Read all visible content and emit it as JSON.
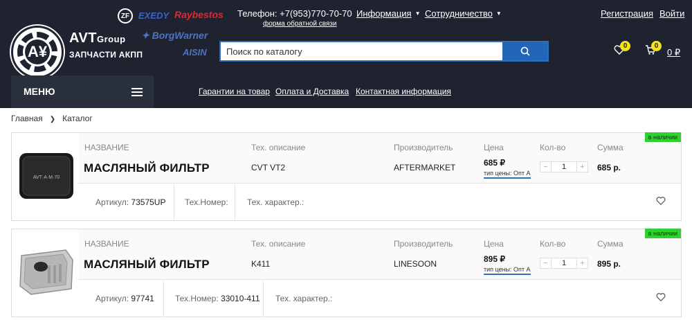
{
  "header": {
    "logo_letter": "A¥",
    "brand_title": "AVT",
    "brand_suffix": "Group",
    "brand_subtitle": "ЗАПЧАСТИ АКПП",
    "partners": [
      "ZF",
      "EXEDY",
      "Raybestos",
      "BorgWarner",
      "AISIN"
    ],
    "phone": "Телефон: +7(953)770-70-70",
    "feedback_link": "форма обратной связи",
    "nav": [
      {
        "label": "Информация",
        "icon": "caret-down-icon"
      },
      {
        "label": "Сотрудничество",
        "icon": "caret-down-icon"
      }
    ],
    "register": "Регистрация",
    "login": "Войти",
    "search_placeholder": "Поиск по каталогу",
    "wishlist_count": "0",
    "cart_count": "0",
    "cart_sum": "0 ₽",
    "menu_label": "МЕНЮ",
    "subnav": [
      "Гарантии на товар",
      "Оплата и Доставка",
      "Контактная информация"
    ]
  },
  "breadcrumb": [
    "Главная",
    "Каталог"
  ],
  "columns": {
    "name": "НАЗВАНИЕ",
    "desc": "Тех. описание",
    "maker": "Производитель",
    "price": "Цена",
    "qty": "Кол-во",
    "sum": "Сумма"
  },
  "products": [
    {
      "name": "МАСЛЯНЫЙ ФИЛЬТР",
      "desc": "CVT VT2",
      "maker": "AFTERMARKET",
      "price": "685 ₽",
      "price_type": "тип цены: Опт А",
      "qty": "1",
      "sum": "685 р.",
      "stock": "в наличии",
      "article_label": "Артикул:",
      "article": "73575UP",
      "tech_no_label": "Тех.Номер:",
      "tech_no": "",
      "tech_char_label": "Тех. характер.:",
      "image_label": "AVT·A·M·70"
    },
    {
      "name": "МАСЛЯНЫЙ ФИЛЬТР",
      "desc": "K411",
      "maker": "LINESOON",
      "price": "895 ₽",
      "price_type": "тип цены: Опт А",
      "qty": "1",
      "sum": "895 р.",
      "stock": "в наличии",
      "article_label": "Артикул:",
      "article": "97741",
      "tech_no_label": "Тех.Номер:",
      "tech_no": "33010-411",
      "tech_char_label": "Тех. характер.:"
    }
  ],
  "colors": {
    "header_bg": "#1f2330",
    "accent_blue": "#2166b8",
    "badge_yellow": "#f4e21b",
    "stock_green": "#2fd12f"
  }
}
